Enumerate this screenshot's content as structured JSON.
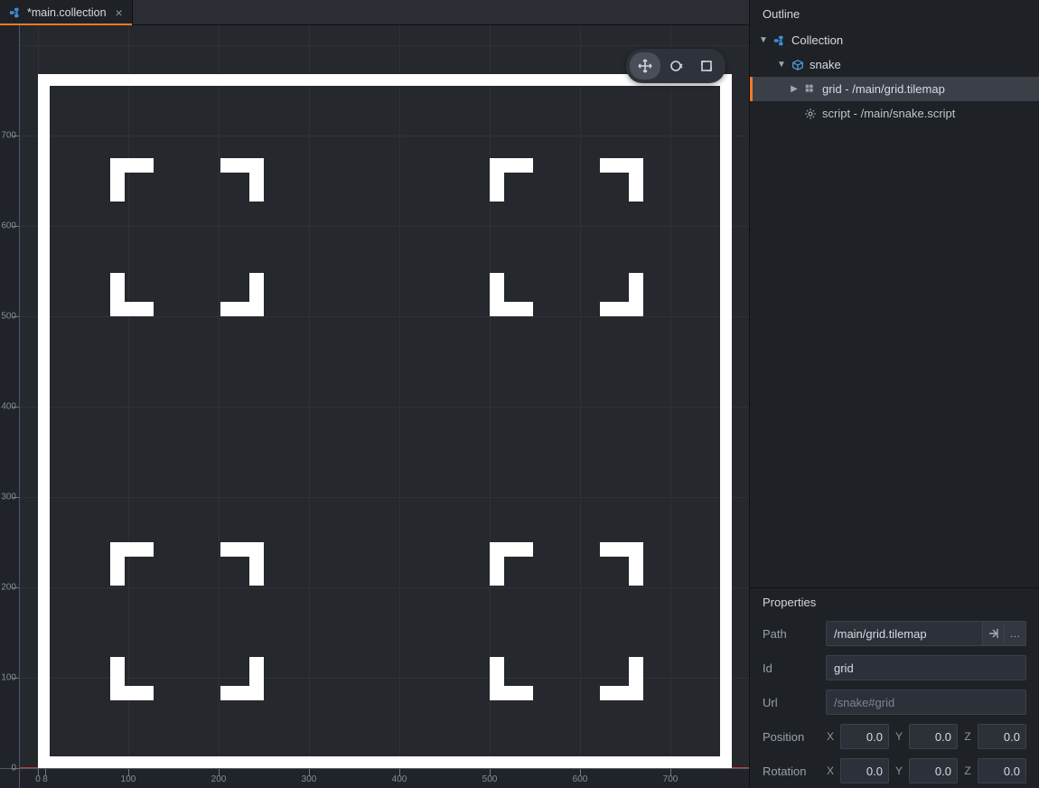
{
  "tab": {
    "title": "*main.collection"
  },
  "ruler": {
    "v": [
      "0",
      "100",
      "200",
      "300",
      "400",
      "500",
      "600",
      "700"
    ],
    "h": [
      "0",
      "100",
      "200",
      "300",
      "400",
      "500",
      "600",
      "700",
      "8"
    ]
  },
  "outline": {
    "title": "Outline",
    "nodes": {
      "root": "Collection",
      "snake": "snake",
      "grid": "grid - /main/grid.tilemap",
      "script": "script - /main/snake.script"
    }
  },
  "properties": {
    "title": "Properties",
    "labels": {
      "path": "Path",
      "id": "Id",
      "url": "Url",
      "position": "Position",
      "rotation": "Rotation",
      "x": "X",
      "y": "Y",
      "z": "Z"
    },
    "path": "/main/grid.tilemap",
    "id": "grid",
    "url": "/snake#grid",
    "position": {
      "x": "0.0",
      "y": "0.0",
      "z": "0.0"
    },
    "rotation": {
      "x": "0.0",
      "y": "0.0",
      "z": "0.0"
    }
  },
  "toolbar": {
    "move": "move",
    "rotate": "rotate",
    "scale": "scale"
  }
}
